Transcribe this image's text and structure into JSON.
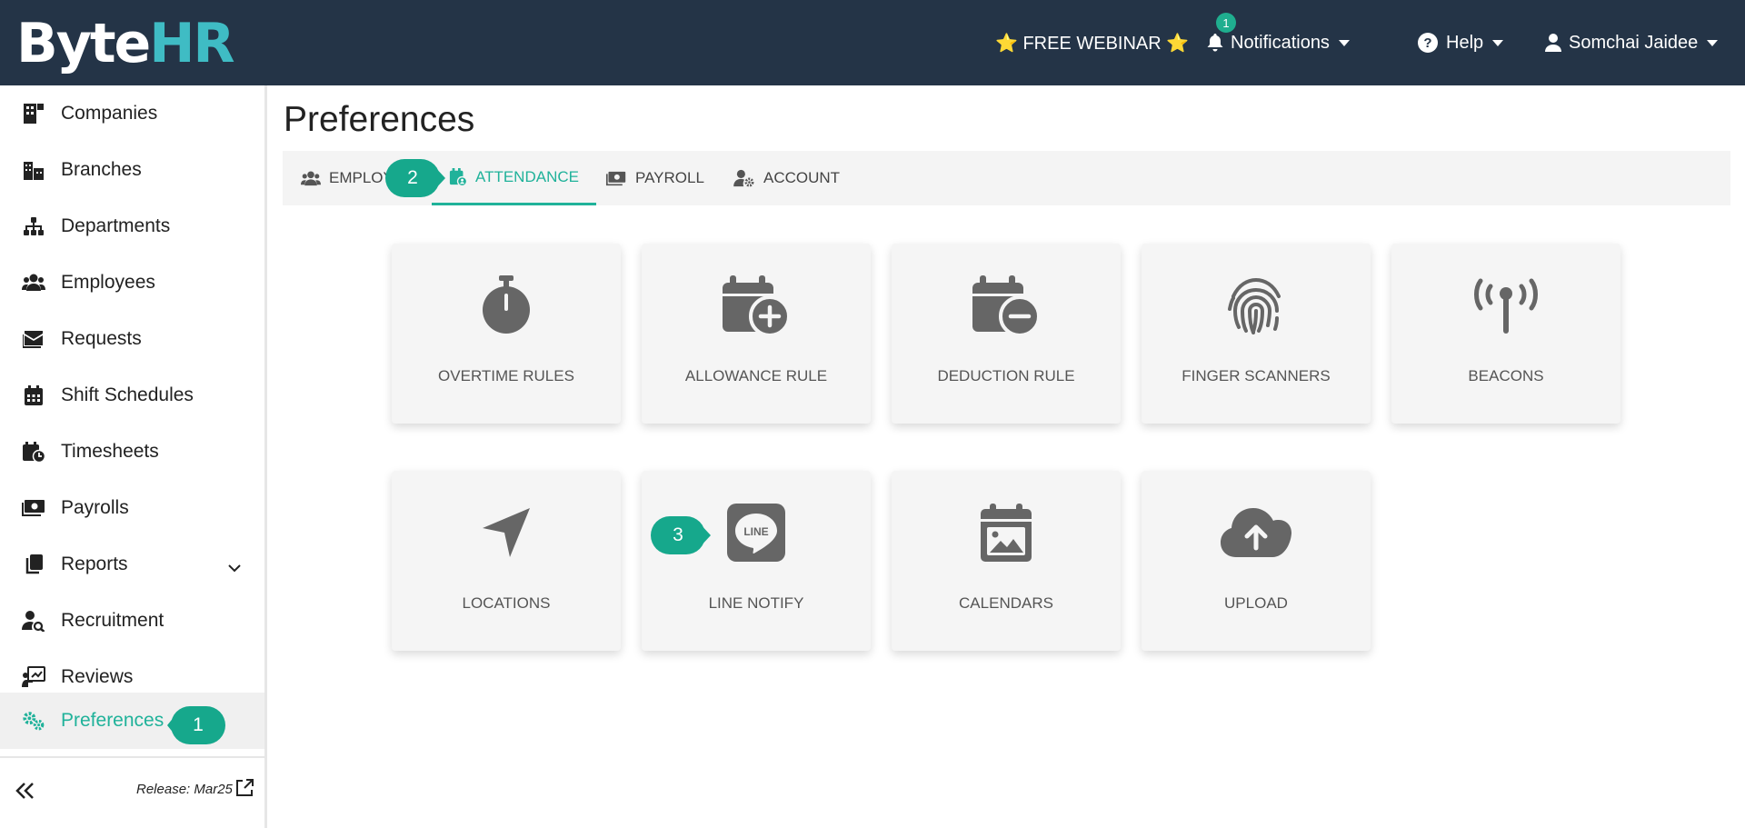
{
  "header": {
    "logo_part1": "Bуte",
    "logo_part2": "HR",
    "webinar_label": "⭐ FREE WEBINAR ⭐",
    "notifications_label": "Notifications",
    "notifications_count": "1",
    "help_label": "Help",
    "user_name": "Somchai Jaidee"
  },
  "sidebar": {
    "items": [
      {
        "label": "Companies",
        "icon": "building-icon"
      },
      {
        "label": "Branches",
        "icon": "city-icon"
      },
      {
        "label": "Departments",
        "icon": "sitemap-icon"
      },
      {
        "label": "Employees",
        "icon": "users-icon"
      },
      {
        "label": "Requests",
        "icon": "envelope-icon"
      },
      {
        "label": "Shift Schedules",
        "icon": "calendar-icon"
      },
      {
        "label": "Timesheets",
        "icon": "calendar-clock-icon"
      },
      {
        "label": "Payrolls",
        "icon": "money-icon"
      },
      {
        "label": "Reports",
        "icon": "copy-icon"
      },
      {
        "label": "Recruitment",
        "icon": "user-search-icon"
      },
      {
        "label": "Reviews",
        "icon": "chart-board-icon"
      },
      {
        "label": "Preferences",
        "icon": "gears-icon"
      }
    ],
    "release": "Release: Mar25"
  },
  "main": {
    "title": "Preferences",
    "tabs": [
      {
        "label": "EMPLOY",
        "icon": "users-icon"
      },
      {
        "label": "ATTENDANCE",
        "icon": "calendar-user-icon"
      },
      {
        "label": "PAYROLL",
        "icon": "money-icon"
      },
      {
        "label": "ACCOUNT",
        "icon": "user-gear-icon"
      }
    ],
    "cards": [
      {
        "label": "OVERTIME RULES",
        "icon": "stopwatch-icon"
      },
      {
        "label": "ALLOWANCE RULE",
        "icon": "calendar-plus-icon"
      },
      {
        "label": "DEDUCTION RULE",
        "icon": "calendar-minus-icon"
      },
      {
        "label": "FINGER SCANNERS",
        "icon": "fingerprint-icon"
      },
      {
        "label": "BEACONS",
        "icon": "tower-broadcast-icon"
      },
      {
        "label": "LOCATIONS",
        "icon": "location-arrow-icon"
      },
      {
        "label": "LINE NOTIFY",
        "icon": "line-icon"
      },
      {
        "label": "CALENDARS",
        "icon": "calendar-image-icon"
      },
      {
        "label": "UPLOAD",
        "icon": "cloud-upload-icon"
      }
    ],
    "line_icon_text": "LINE"
  },
  "callouts": [
    "1",
    "2",
    "3"
  ],
  "colors": {
    "header_bg": "#243447",
    "accent": "#20b29a",
    "callout": "#16a88c",
    "logo_hr": "#3fbcc4",
    "icon_gray": "#666666"
  }
}
